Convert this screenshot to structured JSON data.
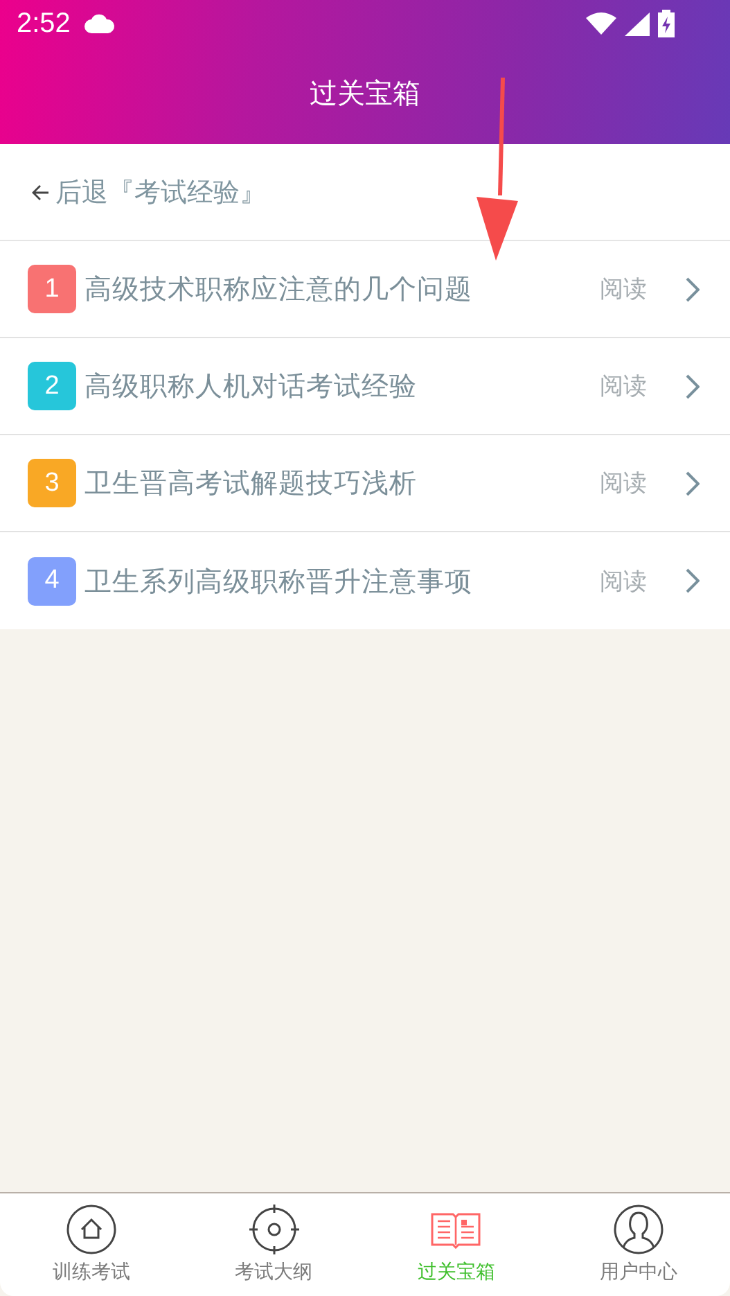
{
  "status_bar": {
    "time": "2:52"
  },
  "header": {
    "title": "过关宝箱"
  },
  "back": {
    "label": "后退『考试经验』"
  },
  "items": [
    {
      "number": "1",
      "title": "高级技术职称应注意的几个问题",
      "action": "阅读",
      "color": "#f87272"
    },
    {
      "number": "2",
      "title": "高级职称人机对话考试经验",
      "action": "阅读",
      "color": "#26c6da"
    },
    {
      "number": "3",
      "title": "卫生晋高考试解题技巧浅析",
      "action": "阅读",
      "color": "#f9a825"
    },
    {
      "number": "4",
      "title": "卫生系列高级职称晋升注意事项",
      "action": "阅读",
      "color": "#82a0fc"
    }
  ],
  "tabs": [
    {
      "label": "训练考试",
      "kind": "home",
      "selected": false
    },
    {
      "label": "考试大纲",
      "kind": "target",
      "selected": false
    },
    {
      "label": "过关宝箱",
      "kind": "book",
      "selected": true
    },
    {
      "label": "用户中心",
      "kind": "user",
      "selected": false
    }
  ]
}
